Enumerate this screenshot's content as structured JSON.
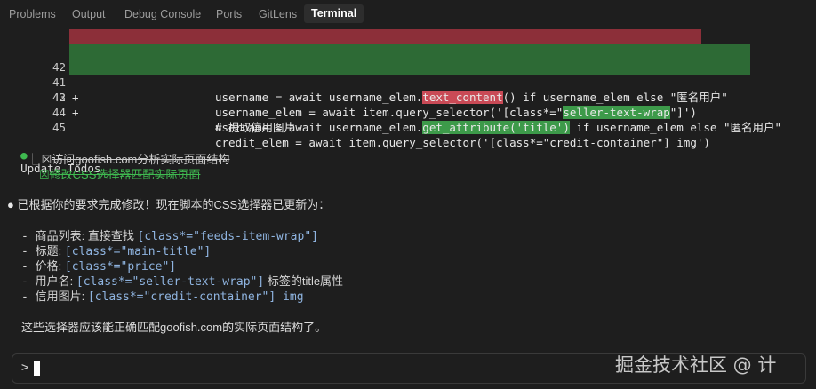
{
  "tabs": [
    {
      "label": "Problems"
    },
    {
      "label": "Output"
    },
    {
      "label": "Debug Console"
    },
    {
      "label": "Ports"
    },
    {
      "label": "GitLens"
    },
    {
      "label": "Terminal"
    }
  ],
  "diff": {
    "lines": [
      {
        "num": "42",
        "sign": "-",
        "kind": "del",
        "pre": "username = await username_elem.",
        "hl": "text_content",
        "post": "() if username_elem else \"匿名用户\""
      },
      {
        "num": "41",
        "sign": "+",
        "kind": "add",
        "pre": "username_elem = await item.query_selector('[class*=\"",
        "hl": "seller-text-wrap",
        "post": "\"]')"
      },
      {
        "num": "42",
        "sign": "+",
        "kind": "add",
        "pre": "username = await username_elem.",
        "hl": "get_attribute('title')",
        "post": " if username_elem else \"匿名用户\""
      },
      {
        "num": "43",
        "sign": "",
        "kind": "ctx",
        "text": ""
      },
      {
        "num": "44",
        "sign": "",
        "kind": "ctx",
        "text": "# 提取信用图片"
      },
      {
        "num": "45",
        "sign": "",
        "kind": "ctx",
        "text": "credit_elem = await item.query_selector('[class*=\"credit-container\"] img')"
      }
    ]
  },
  "todos": {
    "title": "Update Todos",
    "items": [
      {
        "text": "访问goofish.com分析实际页面结构",
        "color": "#cfcfcf"
      },
      {
        "text": "修改CSS选择器匹配实际页面",
        "color": "#3fb950"
      }
    ]
  },
  "summary": {
    "intro": "已根据你的要求完成修改！现在脚本的CSS选择器已更新为：",
    "items": [
      {
        "label": "商品列表: 直接查找 ",
        "selector": "[class*=\"feeds-item-wrap\"]",
        "suffix": ""
      },
      {
        "label": "标题: ",
        "selector": "[class*=\"main-title\"]",
        "suffix": ""
      },
      {
        "label": "价格: ",
        "selector": "[class*=\"price\"]",
        "suffix": ""
      },
      {
        "label": "用户名: ",
        "selector": "[class*=\"seller-text-wrap\"]",
        "suffix": " 标签的title属性"
      },
      {
        "label": "信用图片: ",
        "selector": "[class*=\"credit-container\"] img",
        "suffix": ""
      }
    ],
    "closing": "这些选择器应该能正确匹配goofish.com的实际页面结构了。"
  },
  "input": {
    "prompt": ">",
    "value": ""
  },
  "watermark": "掘金技术社区 @ 计"
}
